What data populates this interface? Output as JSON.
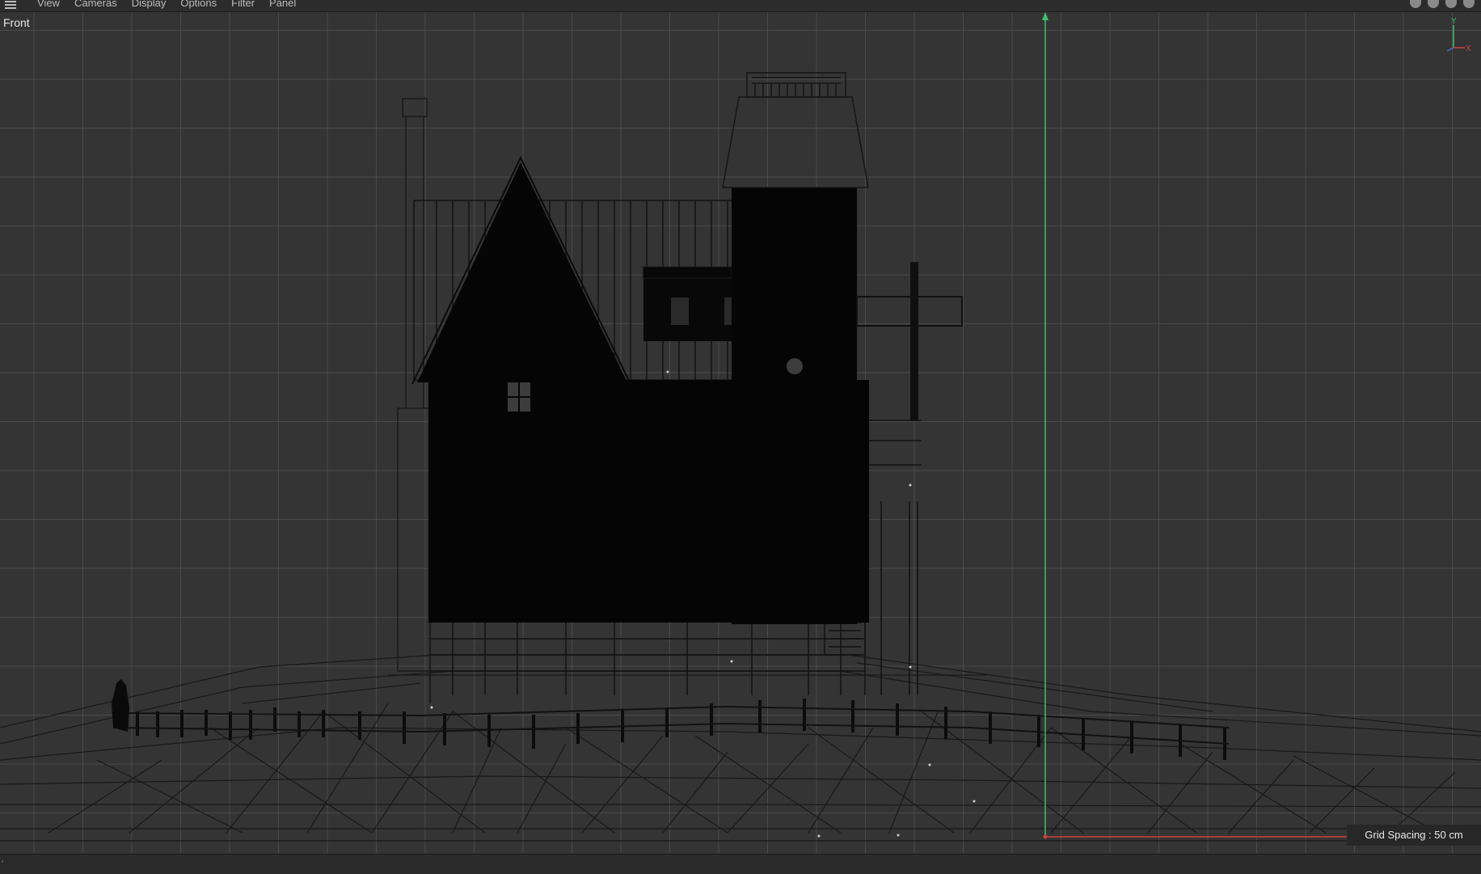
{
  "menubar": {
    "items": [
      "View",
      "Cameras",
      "Display",
      "Options",
      "Filter",
      "Panel"
    ],
    "menu_icon": "hamburger-menu-icon",
    "right_icons": [
      "move-view-icon",
      "down-arrow-icon",
      "record-icon",
      "maximize-icon"
    ]
  },
  "viewport": {
    "label": "Front",
    "grid_spacing_text": "Grid Spacing : 50 cm",
    "axis_labels": {
      "y": "Y",
      "x": "X"
    }
  },
  "statusbar": {
    "text": "ʻ"
  },
  "colors": {
    "background": "#343434",
    "grid": "#4e4e4e",
    "y_axis": "#3fbf6f",
    "x_axis": "#d04040",
    "silhouette": "#050505",
    "wire": "#151515"
  }
}
